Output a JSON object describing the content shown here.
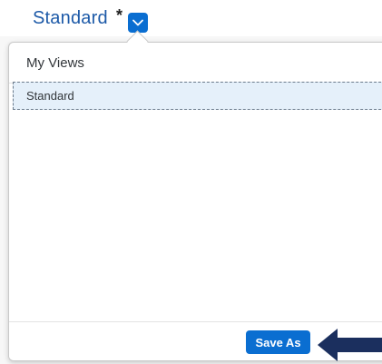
{
  "header": {
    "view_name": "Standard",
    "dirty_marker": "*",
    "toggle_icon": "chevron-down-icon"
  },
  "popover": {
    "title": "My Views",
    "items": [
      {
        "label": "Standard",
        "selected": true
      }
    ],
    "save_as_label": "Save As"
  },
  "colors": {
    "accent": "#0a6ed1",
    "title_text": "#1d5aa8",
    "selected_row": "#e5f0fa",
    "annotation_arrow": "#1b2f5e"
  }
}
